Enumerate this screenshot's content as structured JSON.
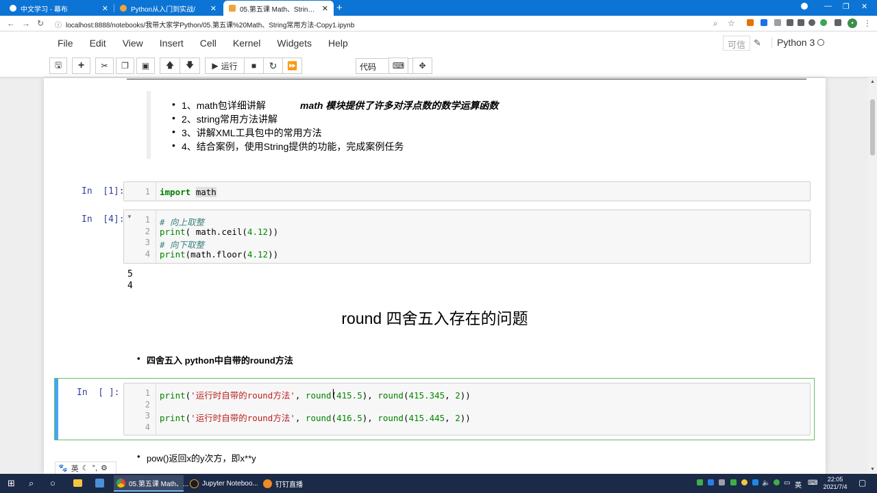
{
  "browser": {
    "tabs": [
      {
        "title": "中文学习 - 幕布",
        "active": false
      },
      {
        "title": "Python从入门到实战/",
        "active": false
      },
      {
        "title": "05.第五课 Math、String常用方法",
        "active": true
      }
    ],
    "url": "localhost:8888/notebooks/我带大家学Python/05.第五课%20Math、String常用方法-Copy1.ipynb"
  },
  "jupyter": {
    "menu": [
      "File",
      "Edit",
      "View",
      "Insert",
      "Cell",
      "Kernel",
      "Widgets",
      "Help"
    ],
    "trusted_label": "可信",
    "kernel_name": "Python 3",
    "run_label": "运行",
    "cell_type": "代码"
  },
  "notebook": {
    "intro_items": [
      "1、math包详细讲解",
      "2、string常用方法讲解",
      "3、讲解XML工具包中的常用方法",
      "4、结合案例，使用String提供的功能，完成案例任务"
    ],
    "math_note": "math 模块提供了许多对浮点数的数学运算函数",
    "cell1": {
      "prompt": "In  [1]:",
      "kw": "import",
      "mod": "math"
    },
    "cell2": {
      "prompt": "In  [4]:",
      "comment1": "# 向上取整",
      "comment2": "# 向下取整",
      "outputs": [
        "5",
        "4"
      ]
    },
    "heading": "round 四舍五入存在的问题",
    "subheading": "四舍五入 python中自带的round方法",
    "cell3": {
      "prompt": "In  [ ]:",
      "str1": "'运行时自带的round方法'",
      "str2": "'运行时自带的round方法'"
    },
    "pow_text": "pow()返回x的y次方，即x**y"
  },
  "ime": {
    "lang": "英"
  },
  "taskbar": {
    "apps": [
      {
        "label": "05.第五课 Math、..."
      },
      {
        "label": "Jupyter Noteboo..."
      },
      {
        "label": "钉钉直播"
      }
    ],
    "ime_lang": "英",
    "time": "22:05",
    "date": "2021/7/4"
  }
}
